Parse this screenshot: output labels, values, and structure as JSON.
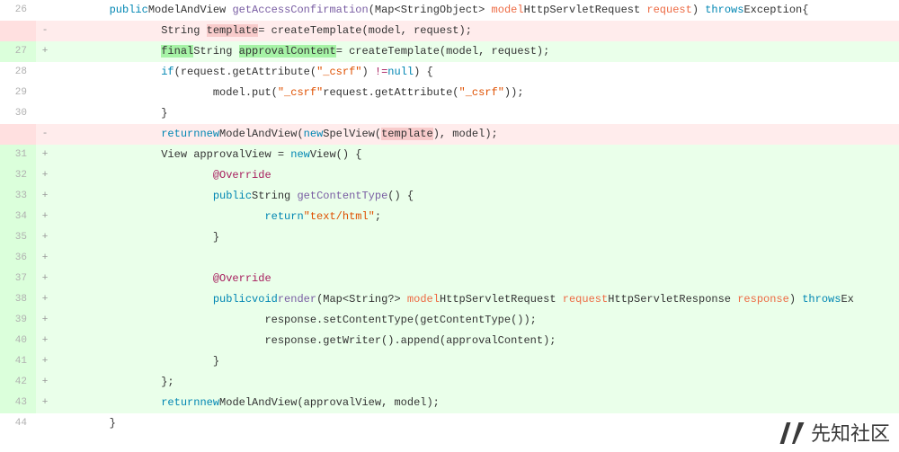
{
  "lines": [
    {
      "num": "26",
      "mark": "",
      "cls": "ctx",
      "indent": "        ",
      "tokens": [
        [
          "kw",
          "public"
        ],
        [
          "",
          ", ModelAndView "
        ],
        [
          "meth",
          "getAccessConfirmation"
        ],
        [
          "",
          "(Map<"
        ],
        [
          "",
          "String"
        ],
        [
          "",
          ", "
        ],
        [
          "",
          "Object"
        ],
        [
          "",
          "> "
        ],
        [
          "param",
          "model"
        ],
        [
          "",
          ", HttpServletRequest "
        ],
        [
          "param",
          "request"
        ],
        [
          "",
          ") "
        ],
        [
          "kw",
          "throws"
        ],
        [
          "",
          ", "
        ],
        [
          "",
          "Exception"
        ],
        [
          "",
          ", {"
        ]
      ]
    },
    {
      "num": "",
      "mark": "-",
      "cls": "del",
      "indent": "                ",
      "tokens": [
        [
          "",
          "String "
        ],
        [
          "hl-red",
          "template"
        ],
        [
          "",
          ", = createTemplate(model, request);"
        ]
      ]
    },
    {
      "num": "27",
      "mark": "+",
      "cls": "add",
      "indent": "                ",
      "tokens": [
        [
          "hl-green",
          "final"
        ],
        [
          "",
          ", String "
        ],
        [
          "hl-green",
          "approvalContent"
        ],
        [
          "",
          ", = createTemplate(model, request);"
        ]
      ]
    },
    {
      "num": "28",
      "mark": "",
      "cls": "ctx",
      "indent": "                ",
      "tokens": [
        [
          "kw",
          "if"
        ],
        [
          "",
          ", (request.getAttribute("
        ],
        [
          "str",
          "\"_csrf\""
        ],
        [
          "",
          ") "
        ],
        [
          "op",
          "!="
        ],
        [
          "",
          ", "
        ],
        [
          "null",
          "null"
        ],
        [
          "",
          ") {"
        ]
      ]
    },
    {
      "num": "29",
      "mark": "",
      "cls": "ctx",
      "indent": "                        ",
      "tokens": [
        [
          "",
          "model.put("
        ],
        [
          "str",
          "\"_csrf\""
        ],
        [
          "",
          ", request.getAttribute("
        ],
        [
          "str",
          "\"_csrf\""
        ],
        [
          "",
          "));"
        ]
      ]
    },
    {
      "num": "30",
      "mark": "",
      "cls": "ctx",
      "indent": "                ",
      "tokens": [
        [
          "",
          "}"
        ]
      ]
    },
    {
      "num": "",
      "mark": "-",
      "cls": "del",
      "indent": "                ",
      "tokens": [
        [
          "kw",
          "return"
        ],
        [
          "",
          ", "
        ],
        [
          "kw",
          "new"
        ],
        [
          "",
          ", ModelAndView("
        ],
        [
          "kw",
          "new"
        ],
        [
          "",
          ", SpelView("
        ],
        [
          "hl-red",
          "template"
        ],
        [
          "",
          "), model);"
        ]
      ]
    },
    {
      "num": "31",
      "mark": "+",
      "cls": "add",
      "indent": "                ",
      "tokens": [
        [
          "",
          "View approvalView = "
        ],
        [
          "kw",
          "new"
        ],
        [
          "",
          ", View() {"
        ]
      ]
    },
    {
      "num": "32",
      "mark": "+",
      "cls": "add",
      "indent": "                        ",
      "tokens": [
        [
          "ann",
          "@Override"
        ]
      ]
    },
    {
      "num": "33",
      "mark": "+",
      "cls": "add",
      "indent": "                        ",
      "tokens": [
        [
          "kw",
          "public"
        ],
        [
          "",
          ", String "
        ],
        [
          "meth",
          "getContentType"
        ],
        [
          "",
          "() {"
        ]
      ]
    },
    {
      "num": "34",
      "mark": "+",
      "cls": "add",
      "indent": "                                ",
      "tokens": [
        [
          "kw",
          "return"
        ],
        [
          "",
          ", "
        ],
        [
          "str",
          "\"text/html\""
        ],
        [
          "",
          ";"
        ]
      ]
    },
    {
      "num": "35",
      "mark": "+",
      "cls": "add",
      "indent": "                        ",
      "tokens": [
        [
          "",
          "}"
        ]
      ]
    },
    {
      "num": "36",
      "mark": "+",
      "cls": "add",
      "indent": "",
      "tokens": [
        [
          "",
          ""
        ]
      ]
    },
    {
      "num": "37",
      "mark": "+",
      "cls": "add",
      "indent": "                        ",
      "tokens": [
        [
          "ann",
          "@Override"
        ]
      ]
    },
    {
      "num": "38",
      "mark": "+",
      "cls": "add",
      "indent": "                        ",
      "tokens": [
        [
          "kw",
          "public"
        ],
        [
          "",
          ", "
        ],
        [
          "kw",
          "void"
        ],
        [
          "",
          ", "
        ],
        [
          "meth",
          "render"
        ],
        [
          "",
          "(Map<"
        ],
        [
          "",
          "String"
        ],
        [
          "",
          ", "
        ],
        [
          "",
          "?"
        ],
        [
          "",
          "> "
        ],
        [
          "param",
          "model"
        ],
        [
          "",
          ", HttpServletRequest "
        ],
        [
          "param",
          "request"
        ],
        [
          "",
          ", HttpServletResponse "
        ],
        [
          "param",
          "response"
        ],
        [
          "",
          ") "
        ],
        [
          "kw",
          "throws"
        ],
        [
          "",
          ", Ex"
        ]
      ]
    },
    {
      "num": "39",
      "mark": "+",
      "cls": "add",
      "indent": "                                ",
      "tokens": [
        [
          "",
          "response.setContentType(getContentType());"
        ]
      ]
    },
    {
      "num": "40",
      "mark": "+",
      "cls": "add",
      "indent": "                                ",
      "tokens": [
        [
          "",
          "response.getWriter().append(approvalContent);"
        ]
      ]
    },
    {
      "num": "41",
      "mark": "+",
      "cls": "add",
      "indent": "                        ",
      "tokens": [
        [
          "",
          "}"
        ]
      ]
    },
    {
      "num": "42",
      "mark": "+",
      "cls": "add",
      "indent": "                ",
      "tokens": [
        [
          "",
          "};"
        ]
      ]
    },
    {
      "num": "43",
      "mark": "+",
      "cls": "add",
      "indent": "                ",
      "tokens": [
        [
          "kw",
          "return"
        ],
        [
          "",
          ", "
        ],
        [
          "kw",
          "new"
        ],
        [
          "",
          ", ModelAndView(approvalView, model);"
        ]
      ]
    },
    {
      "num": "44",
      "mark": "",
      "cls": "ctx",
      "indent": "        ",
      "tokens": [
        [
          "",
          "}"
        ]
      ]
    }
  ],
  "watermark_text": "先知社区"
}
